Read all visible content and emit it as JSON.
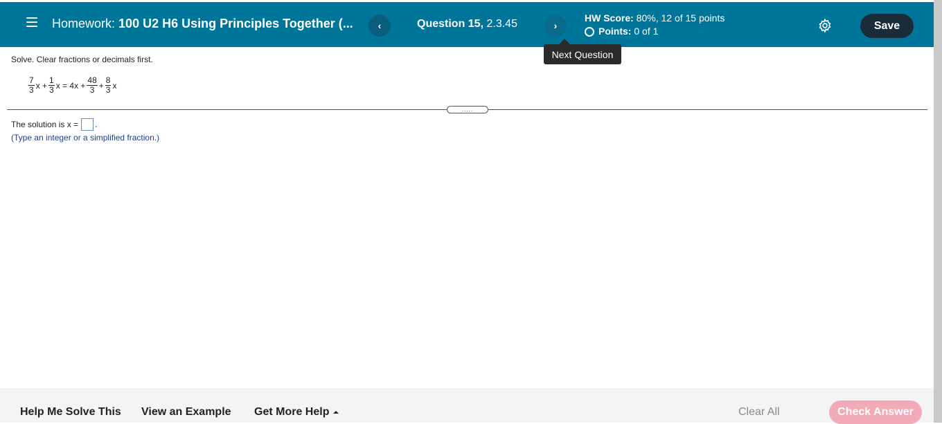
{
  "header": {
    "title_prefix": "Homework:",
    "title_name": "100 U2 H6 Using Principles Together (...",
    "prev_label": "‹",
    "next_label": "›",
    "question_label": "Question 15,",
    "question_ref": "2.3.45",
    "hw_score_label": "HW Score:",
    "hw_score_value": "80%, 12 of 15 points",
    "points_label": "Points:",
    "points_value": "0 of 1",
    "save_label": "Save"
  },
  "tooltip": {
    "text": "Next Question"
  },
  "question": {
    "instruction": "Solve. Clear fractions or decimals first.",
    "equation": {
      "f1_num": "7",
      "f1_den": "3",
      "t1": "x +",
      "f2_num": "1",
      "f2_den": "3",
      "t2": "x = 4x +",
      "f3_num": "48",
      "f3_den": "3",
      "t3": "+",
      "f4_num": "8",
      "f4_den": "3",
      "t4": "x"
    },
    "answer_prefix": "The solution is x =",
    "answer_value": "",
    "answer_suffix": ".",
    "hint": "(Type an integer or a simplified fraction.)",
    "handle_dots": "....."
  },
  "footer": {
    "help_solve": "Help Me Solve This",
    "view_example": "View an Example",
    "more_help": "Get More Help",
    "clear_all": "Clear All",
    "check_answer": "Check Answer"
  },
  "colors": {
    "header_bg": "#00759a",
    "save_bg": "#1a2b3a",
    "check_bg": "#f2a9b8",
    "hint_text": "#1c3f94"
  },
  "icons": {
    "menu": "hamburger-icon",
    "settings": "gear-icon",
    "points": "circle-icon",
    "more_help": "caret-up-icon"
  }
}
